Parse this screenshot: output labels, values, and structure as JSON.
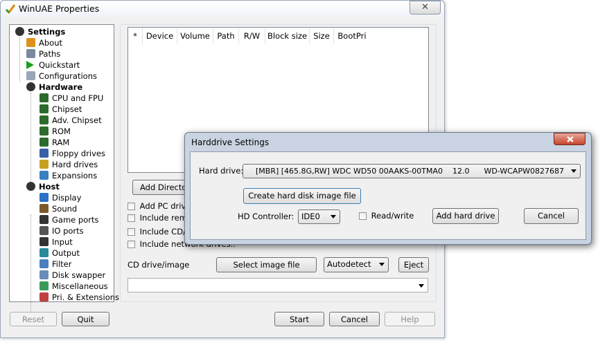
{
  "window": {
    "title": "WinUAE Properties",
    "close_glyph": "✕"
  },
  "sidebar": {
    "items": [
      {
        "label": "Settings",
        "icon": "settings-disk-icon",
        "bold": true,
        "level": 0
      },
      {
        "label": "About",
        "icon": "about-check-icon",
        "level": 1
      },
      {
        "label": "Paths",
        "icon": "paths-icon",
        "level": 1
      },
      {
        "label": "Quickstart",
        "icon": "quickstart-play-icon",
        "level": 1
      },
      {
        "label": "Configurations",
        "icon": "configurations-icon",
        "level": 1
      },
      {
        "label": "Hardware",
        "icon": "hardware-disk-icon",
        "bold": true,
        "level": 1
      },
      {
        "label": "CPU and FPU",
        "icon": "chip-icon",
        "level": 2
      },
      {
        "label": "Chipset",
        "icon": "chip-icon",
        "level": 2
      },
      {
        "label": "Adv. Chipset",
        "icon": "chip-icon",
        "level": 2
      },
      {
        "label": "ROM",
        "icon": "chip-icon",
        "level": 2
      },
      {
        "label": "RAM",
        "icon": "chip-icon",
        "level": 2
      },
      {
        "label": "Floppy drives",
        "icon": "floppy-icon",
        "level": 2
      },
      {
        "label": "Hard drives",
        "icon": "harddrive-icon",
        "level": 2
      },
      {
        "label": "Expansions",
        "icon": "expansions-icon",
        "level": 2
      },
      {
        "label": "Host",
        "icon": "host-disk-icon",
        "bold": true,
        "level": 1
      },
      {
        "label": "Display",
        "icon": "display-icon",
        "level": 2
      },
      {
        "label": "Sound",
        "icon": "sound-icon",
        "level": 2
      },
      {
        "label": "Game ports",
        "icon": "joystick-icon",
        "level": 2
      },
      {
        "label": "IO ports",
        "icon": "io-ports-icon",
        "level": 2
      },
      {
        "label": "Input",
        "icon": "joystick-icon",
        "level": 2
      },
      {
        "label": "Output",
        "icon": "output-icon",
        "level": 2
      },
      {
        "label": "Filter",
        "icon": "filter-icon",
        "level": 2
      },
      {
        "label": "Disk swapper",
        "icon": "disk-swapper-icon",
        "level": 2
      },
      {
        "label": "Miscellaneous",
        "icon": "misc-icon",
        "level": 2
      },
      {
        "label": "Pri. & Extensions",
        "icon": "extensions-icon",
        "level": 2
      }
    ]
  },
  "table": {
    "columns": [
      "*",
      "Device",
      "Volume",
      "Path",
      "R/W",
      "Block size",
      "Size",
      "BootPri"
    ]
  },
  "main": {
    "add_directory_label": "Add Director",
    "checkboxes": [
      "Add PC drives",
      "Include remo",
      "Include CD/D",
      "Include network drives.."
    ],
    "cd_label": "CD drive/image",
    "select_image_label": "Select image file",
    "autodetect_value": "Autodetect",
    "eject_label": "Eject",
    "cd_path_value": ""
  },
  "footer": {
    "reset_label": "Reset",
    "quit_label": "Quit",
    "start_label": "Start",
    "cancel_label": "Cancel",
    "help_label": "Help"
  },
  "dialog": {
    "title": "Harddrive Settings",
    "hard_drive_label": "Hard drive:",
    "hard_drive_value": "[MBR] [465.8G,RW] WDC WD50 00AAKS-00TMA0    12.0      WD-WCAPW0827687",
    "create_image_label": "Create hard disk image file",
    "hd_controller_label": "HD Controller:",
    "hd_controller_value": "IDE0",
    "read_write_label": "Read/write",
    "add_hard_drive_label": "Add hard drive",
    "cancel_label": "Cancel"
  },
  "colors": {
    "window_bg": "#f0f0f0",
    "dialog_frame": "#c9d3e1"
  }
}
